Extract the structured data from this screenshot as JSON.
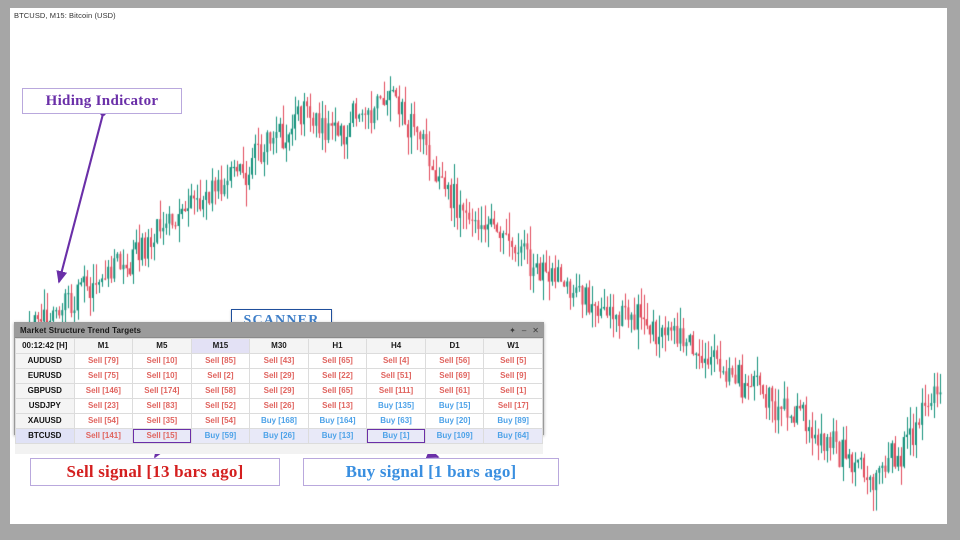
{
  "chart": {
    "title": "BTCUSD, M15:  Bitcoin (USD)",
    "symbol": "BTCUSD",
    "timeframe": "M15",
    "instrument": "Bitcoin (USD)",
    "bull_color": "#13917b",
    "bear_color": "#e0495a",
    "background": "#ffffff",
    "frame_color": "#a6a6a6"
  },
  "annotations": {
    "hiding_indicator": "Hiding Indicator",
    "scanner": "SCANNER",
    "sell_signal": "Sell signal [13 bars ago]",
    "buy_signal": "Buy signal [1 bars ago]",
    "accent_purple": "#6a2fa8",
    "sell_red": "#d41f1f",
    "buy_blue": "#3a8fe0"
  },
  "scanner": {
    "panel_title": "Market Structure Trend Targets",
    "controls": [
      {
        "name": "pin-icon",
        "glyph": "✦"
      },
      {
        "name": "minimize-icon",
        "glyph": "–"
      },
      {
        "name": "close-icon",
        "glyph": "✕"
      }
    ],
    "timer_header": "00:12:42 [H]",
    "timeframes": [
      "M1",
      "M5",
      "M15",
      "M30",
      "H1",
      "H4",
      "D1",
      "W1"
    ],
    "active_timeframe": "M15",
    "active_symbol": "BTCUSD",
    "rows": [
      {
        "symbol": "AUDUSD",
        "cells": [
          {
            "text": "Sell [79]",
            "dir": "sell"
          },
          {
            "text": "Sell [10]",
            "dir": "sell"
          },
          {
            "text": "Sell [85]",
            "dir": "sell"
          },
          {
            "text": "Sell [43]",
            "dir": "sell"
          },
          {
            "text": "Sell [65]",
            "dir": "sell"
          },
          {
            "text": "Sell [4]",
            "dir": "sell"
          },
          {
            "text": "Sell [56]",
            "dir": "sell"
          },
          {
            "text": "Sell [5]",
            "dir": "sell"
          }
        ]
      },
      {
        "symbol": "EURUSD",
        "cells": [
          {
            "text": "Sell [75]",
            "dir": "sell"
          },
          {
            "text": "Sell [10]",
            "dir": "sell"
          },
          {
            "text": "Sell [2]",
            "dir": "sell"
          },
          {
            "text": "Sell [29]",
            "dir": "sell"
          },
          {
            "text": "Sell [22]",
            "dir": "sell"
          },
          {
            "text": "Sell [51]",
            "dir": "sell"
          },
          {
            "text": "Sell [69]",
            "dir": "sell"
          },
          {
            "text": "Sell [9]",
            "dir": "sell"
          }
        ]
      },
      {
        "symbol": "GBPUSD",
        "cells": [
          {
            "text": "Sell [146]",
            "dir": "sell"
          },
          {
            "text": "Sell [174]",
            "dir": "sell"
          },
          {
            "text": "Sell [58]",
            "dir": "sell"
          },
          {
            "text": "Sell [29]",
            "dir": "sell"
          },
          {
            "text": "Sell [65]",
            "dir": "sell"
          },
          {
            "text": "Sell [111]",
            "dir": "sell"
          },
          {
            "text": "Sell [61]",
            "dir": "sell"
          },
          {
            "text": "Sell [1]",
            "dir": "sell"
          }
        ]
      },
      {
        "symbol": "USDJPY",
        "cells": [
          {
            "text": "Sell [23]",
            "dir": "sell"
          },
          {
            "text": "Sell [83]",
            "dir": "sell"
          },
          {
            "text": "Sell [52]",
            "dir": "sell"
          },
          {
            "text": "Sell [26]",
            "dir": "sell"
          },
          {
            "text": "Sell [13]",
            "dir": "sell"
          },
          {
            "text": "Buy [135]",
            "dir": "buy"
          },
          {
            "text": "Buy [15]",
            "dir": "buy"
          },
          {
            "text": "Sell [17]",
            "dir": "sell"
          }
        ]
      },
      {
        "symbol": "XAUUSD",
        "cells": [
          {
            "text": "Sell [54]",
            "dir": "sell"
          },
          {
            "text": "Sell [35]",
            "dir": "sell"
          },
          {
            "text": "Sell [54]",
            "dir": "sell"
          },
          {
            "text": "Buy [168]",
            "dir": "buy"
          },
          {
            "text": "Buy [164]",
            "dir": "buy"
          },
          {
            "text": "Buy [63]",
            "dir": "buy"
          },
          {
            "text": "Buy [20]",
            "dir": "buy"
          },
          {
            "text": "Buy [89]",
            "dir": "buy"
          }
        ]
      },
      {
        "symbol": "BTCUSD",
        "cells": [
          {
            "text": "Sell [141]",
            "dir": "sell"
          },
          {
            "text": "Sell [15]",
            "dir": "sell",
            "highlight": true
          },
          {
            "text": "Buy [59]",
            "dir": "buy"
          },
          {
            "text": "Buy [26]",
            "dir": "buy"
          },
          {
            "text": "Buy [13]",
            "dir": "buy"
          },
          {
            "text": "Buy [1]",
            "dir": "buy",
            "highlight": true
          },
          {
            "text": "Buy [109]",
            "dir": "buy"
          },
          {
            "text": "Buy [64]",
            "dir": "buy"
          }
        ]
      }
    ]
  },
  "chart_data": {
    "type": "candlestick",
    "title": "BTCUSD, M15:  Bitcoin (USD)",
    "xlabel": "",
    "ylabel": "",
    "grid": false,
    "series_note": "15-minute OHLC candles; uptrend to a peak near the left-center, then a sustained downtrend with a late recovery at the far right."
  }
}
